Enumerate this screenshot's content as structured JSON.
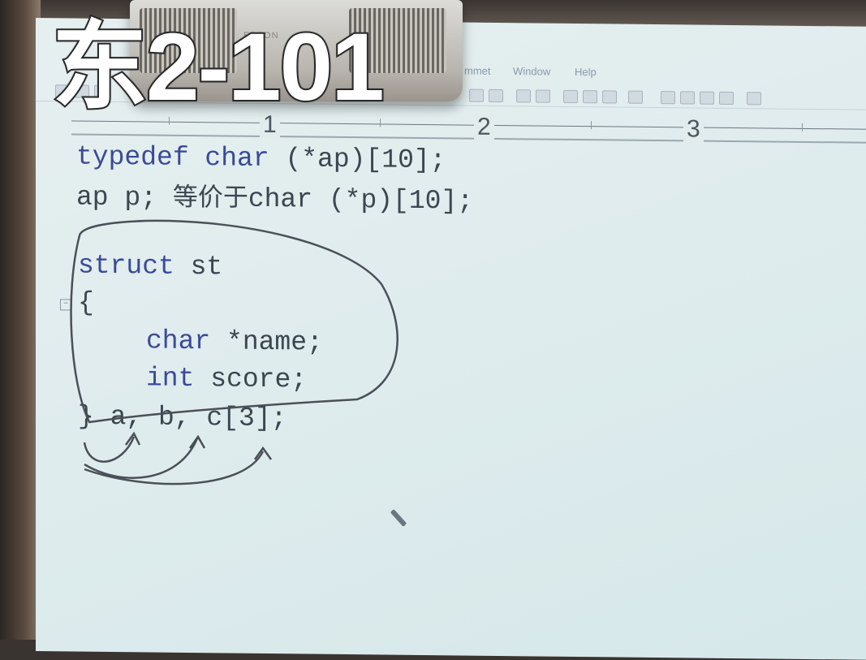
{
  "room_label": "东2-101",
  "projector": {
    "brand": "EPSON"
  },
  "menu": {
    "items": [
      "mmet",
      "Window",
      "Help"
    ]
  },
  "ruler": {
    "marks": [
      "1",
      "2",
      "3"
    ]
  },
  "code": {
    "line1_kw": "typedef char",
    "line1_rest": " (*ap)[10];",
    "line2_a": "ap p; ",
    "line2_cn": "等价于",
    "line2_b": "char (*p)[10];",
    "line3_kw": "struct",
    "line3_rest": " st",
    "line4": "{",
    "line5_kw": "char",
    "line5_rest": " *name;",
    "line6_kw": "int",
    "line6_rest": " score;",
    "line7": "} a, b, c[3];"
  },
  "colors": {
    "keyword": "#3a4a98",
    "text": "#3a4650",
    "screen": "#e2eced"
  }
}
